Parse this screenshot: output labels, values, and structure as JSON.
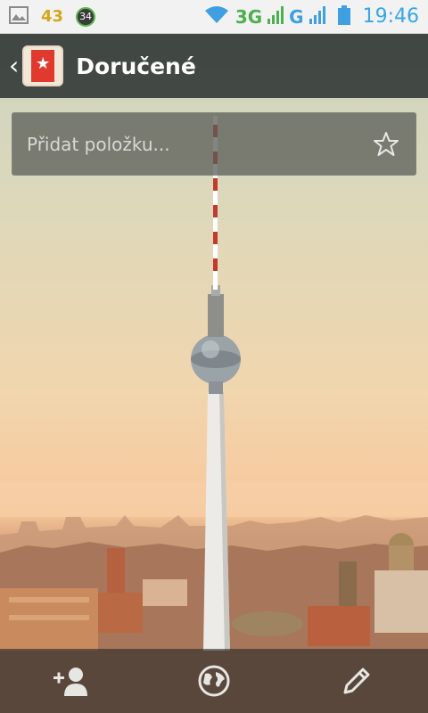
{
  "status_bar": {
    "notification_count": "43",
    "badge_value": "34",
    "network_3g": "3G",
    "network_g": "G",
    "time": "19:46"
  },
  "action_bar": {
    "title": "Doručené"
  },
  "add_item": {
    "placeholder": "Přidat položku..."
  },
  "icons": {
    "image": "image-icon",
    "back": "chevron-left-icon",
    "app": "wunderlist-icon",
    "star": "star-icon",
    "add_person": "add-person-icon",
    "globe": "globe-icon",
    "edit": "pencil-icon"
  },
  "colors": {
    "action_bar": "#2d3432",
    "app_icon_red": "#e03a2f",
    "clock_blue": "#35a6e8"
  }
}
